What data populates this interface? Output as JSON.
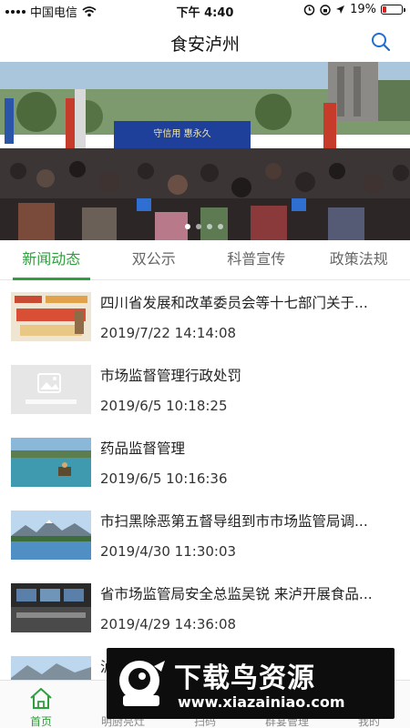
{
  "status_bar": {
    "carrier": "中国电信",
    "time": "下午 4:40",
    "battery": "19%"
  },
  "header": {
    "title": "食安泸州",
    "search_icon": "search-icon"
  },
  "banner": {
    "stage_sign": "守信用 惠永久"
  },
  "tabs": [
    {
      "label": "新闻动态",
      "active": true
    },
    {
      "label": "双公示",
      "active": false
    },
    {
      "label": "科普宣传",
      "active": false
    },
    {
      "label": "政策法规",
      "active": false
    }
  ],
  "news": [
    {
      "title": "四川省发展和改革委员会等十七部门关于...",
      "time": "2019/7/22 14:14:08",
      "thumb": "poster"
    },
    {
      "title": "市场监督管理行政处罚",
      "time": "2019/6/5 10:18:25",
      "thumb": "placeholder"
    },
    {
      "title": "药品监督管理",
      "time": "2019/6/5 10:16:36",
      "thumb": "lake"
    },
    {
      "title": "市扫黑除恶第五督导组到市市场监管局调...",
      "time": "2019/4/30 11:30:03",
      "thumb": "mountain"
    },
    {
      "title": "省市场监管局安全总监吴锐 来泸开展食品...",
      "time": "2019/4/29 14:36:08",
      "thumb": "meeting"
    },
    {
      "title": "泸",
      "time": "",
      "thumb": "mountain"
    }
  ],
  "bottom_nav": [
    {
      "label": "首页",
      "icon": "home-icon",
      "active": true
    },
    {
      "label": "明厨亮灶",
      "icon": "kitchen-icon",
      "active": false
    },
    {
      "label": "扫码",
      "icon": "scan-icon",
      "active": false
    },
    {
      "label": "群宴管理",
      "icon": "banquet-icon",
      "active": false
    },
    {
      "label": "我的",
      "icon": "user-icon",
      "active": false
    }
  ],
  "watermark": {
    "name": "下载鸟资源",
    "url": "www.xiazainiao.com"
  },
  "colors": {
    "accent": "#2f9e3c",
    "battery_low": "#e02020",
    "search": "#1f6fd1"
  }
}
